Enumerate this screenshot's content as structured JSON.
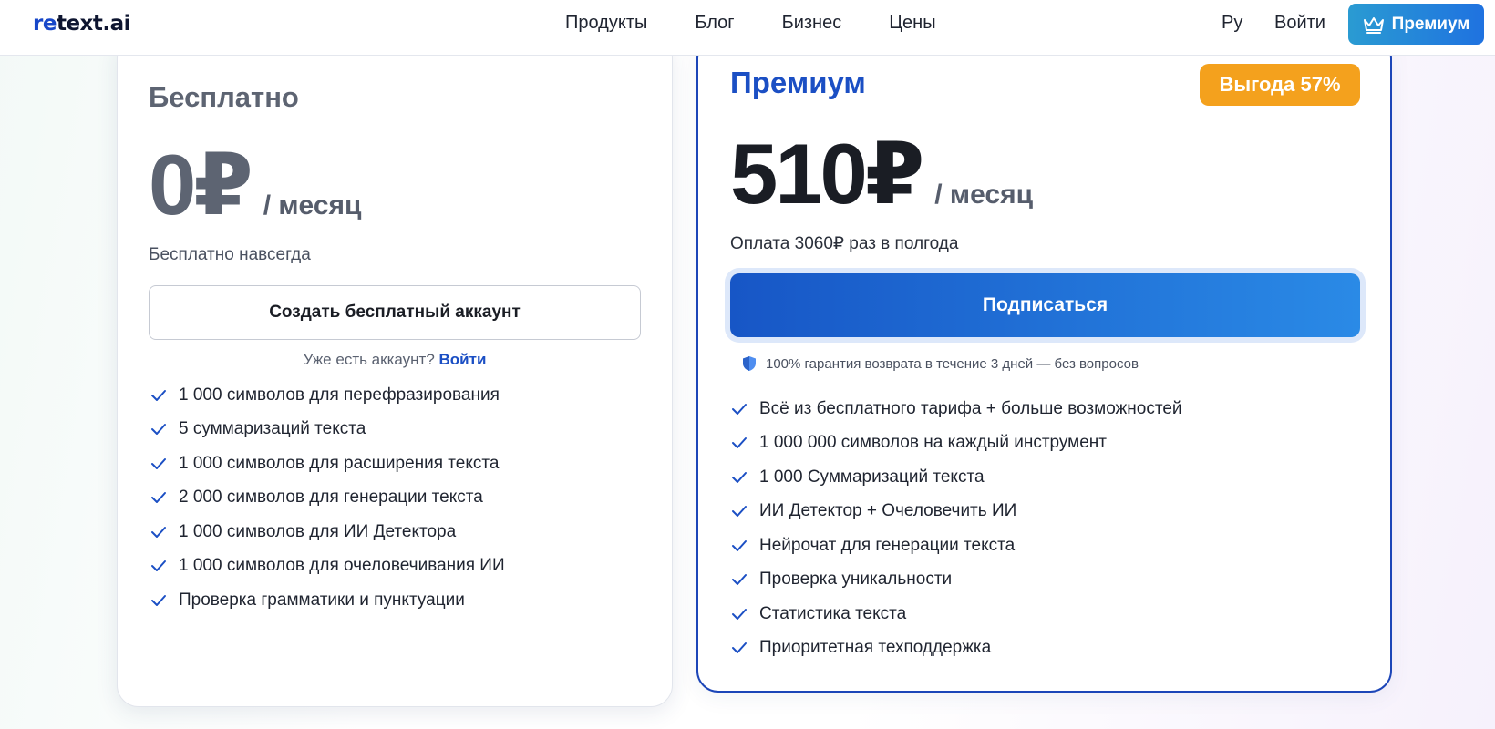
{
  "header": {
    "logo_re": "re",
    "logo_rest": "text.ai",
    "nav": [
      "Продукты",
      "Блог",
      "Бизнес",
      "Цены"
    ],
    "lang": "Ру",
    "login": "Войти",
    "premium": "Премиум"
  },
  "free": {
    "title": "Бесплатно",
    "price": "0₽",
    "per": "/ месяц",
    "subtitle": "Бесплатно навсегда",
    "cta": "Создать бесплатный аккаунт",
    "already_text": "Уже есть аккаунт?",
    "already_link": "Войти",
    "features": [
      "1 000 символов для перефразирования",
      "5 суммаризаций текста",
      "1 000 символов для расширения текста",
      "2 000 символов для генерации текста",
      "1 000 символов для ИИ Детектора",
      "1 000 символов для очеловечивания ИИ",
      "Проверка грамматики и пунктуации"
    ]
  },
  "premium": {
    "title": "Премиум",
    "badge": "Выгода 57%",
    "price": "510₽",
    "per": "/ месяц",
    "subtitle": "Оплата 3060₽ раз в полгода",
    "cta": "Подписаться",
    "guarantee": "100% гарантия возврата в течение 3 дней — без вопросов",
    "features": [
      "Всё из бесплатного тарифа + больше возможностей",
      "1 000 000 символов на каждый инструмент",
      "1 000 Суммаризаций текста",
      "ИИ Детектор + Очеловечить ИИ",
      "Нейрочат для генерации текста",
      "Проверка уникальности",
      "Статистика текста",
      "Приоритетная техподдержка"
    ]
  },
  "colors": {
    "brand_blue": "#1b4fc4",
    "badge_orange": "#f4a11d",
    "check_blue": "#1b4fc4"
  },
  "icons": {
    "premium_button": "crown-icon",
    "feature_bullet": "check-icon",
    "guarantee": "shield-icon"
  }
}
